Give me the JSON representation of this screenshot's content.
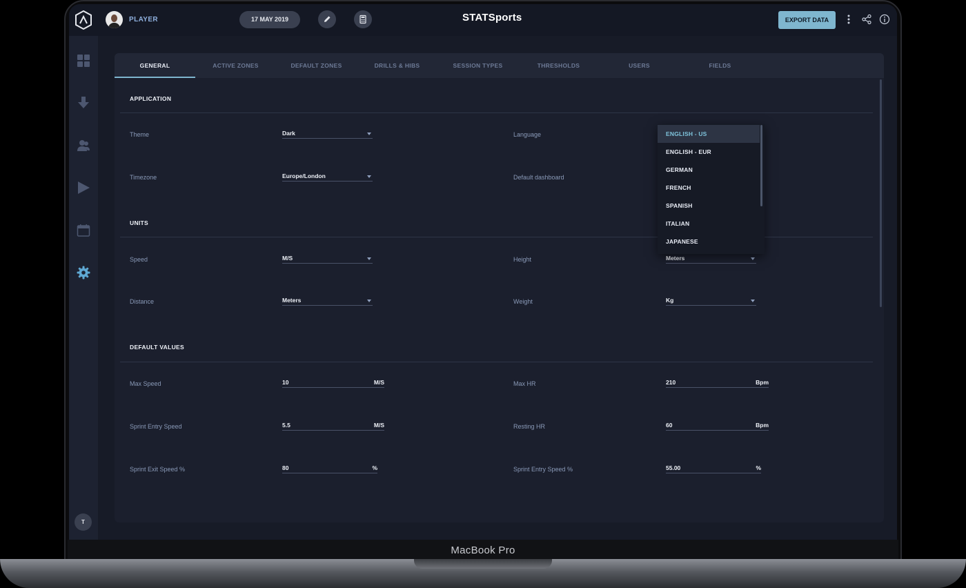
{
  "topbar": {
    "player_label": "PLAYER",
    "date": "17 MAY 2019",
    "brand": "STATSports",
    "export_label": "EXPORT DATA"
  },
  "sidebar": {
    "items": [
      "dashboard-icon",
      "download-icon",
      "users-icon",
      "play-icon",
      "calendar-icon",
      "settings-icon"
    ],
    "user_initial": "T",
    "active_color": "#5fa8d3"
  },
  "tabs": [
    "GENERAL",
    "ACTIVE ZONES",
    "DEFAULT ZONES",
    "DRILLS & HIBS",
    "SESSION TYPES",
    "THRESHOLDS",
    "USERS",
    "FIELDS"
  ],
  "application": {
    "title": "APPLICATION",
    "theme_label": "Theme",
    "theme_value": "Dark",
    "timezone_label": "Timezone",
    "timezone_value": "Europe/London",
    "language_label": "Language",
    "dashboard_label": "Default dashboard"
  },
  "language_options": [
    "ENGLISH - US",
    "ENGLISH - EUR",
    "GERMAN",
    "FRENCH",
    "SPANISH",
    "ITALIAN",
    "JAPANESE"
  ],
  "units": {
    "title": "UNITS",
    "speed_label": "Speed",
    "speed_value": "M/S",
    "distance_label": "Distance",
    "distance_value": "Meters",
    "height_label": "Height",
    "height_value": "Meters",
    "weight_label": "Weight",
    "weight_value": "Kg"
  },
  "defaults": {
    "title": "DEFAULT VALUES",
    "max_speed_label": "Max Speed",
    "max_speed_value": "10",
    "max_speed_unit": "M/S",
    "sprint_entry_label": "Sprint Entry Speed",
    "sprint_entry_value": "5.5",
    "sprint_entry_unit": "M/S",
    "sprint_exit_label": "Sprint Exit Speed %",
    "sprint_exit_value": "80",
    "sprint_exit_unit": "%",
    "max_hr_label": "Max HR",
    "max_hr_value": "210",
    "max_hr_unit": "Bpm",
    "resting_hr_label": "Resting HR",
    "resting_hr_value": "60",
    "resting_hr_unit": "Bpm",
    "sprint_entry_pct_label": "Sprint Entry Speed %",
    "sprint_entry_pct_value": "55.00",
    "sprint_entry_pct_unit": "%"
  },
  "device_label": "MacBook Pro",
  "colors": {
    "accent": "#7fb6cf",
    "background": "#171b27"
  }
}
